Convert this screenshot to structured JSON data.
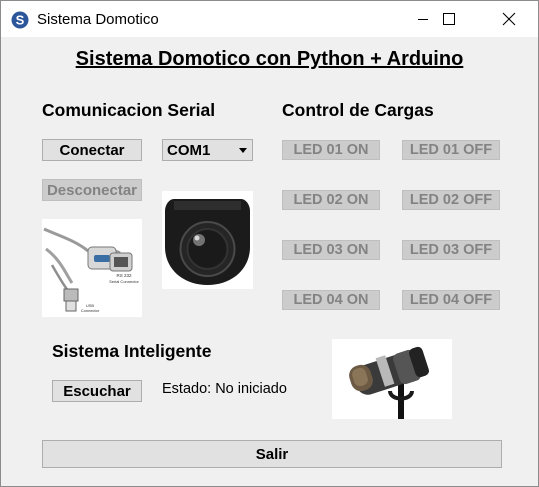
{
  "window": {
    "title": "Sistema Domotico",
    "controls": {
      "minimize": "minimize-icon",
      "maximize": "maximize-icon",
      "close": "close-icon"
    }
  },
  "header": {
    "title": "Sistema Domotico con Python + Arduino"
  },
  "serial": {
    "heading": "Comunicacion Serial",
    "connect_label": "Conectar",
    "disconnect_label": "Desconectar",
    "port_selected": "COM1"
  },
  "loads": {
    "heading": "Control de Cargas",
    "buttons": [
      {
        "on": "LED 01 ON",
        "off": "LED 01 OFF"
      },
      {
        "on": "LED 02 ON",
        "off": "LED 02 OFF"
      },
      {
        "on": "LED 03 ON",
        "off": "LED 03 OFF"
      },
      {
        "on": "LED 04 ON",
        "off": "LED 04 OFF"
      }
    ]
  },
  "cable_image": {
    "label_1": "RS 232",
    "label_2": "Serial Connector",
    "label_3": "USB",
    "label_4": "Connector"
  },
  "smart": {
    "heading": "Sistema Inteligente",
    "listen_label": "Escuchar",
    "status_text": "Estado: No iniciado"
  },
  "exit_label": "Salir",
  "colors": {
    "disabled_text": "#838383",
    "button_bg": "#e1e1e1",
    "window_bg": "#f0f0f0"
  }
}
